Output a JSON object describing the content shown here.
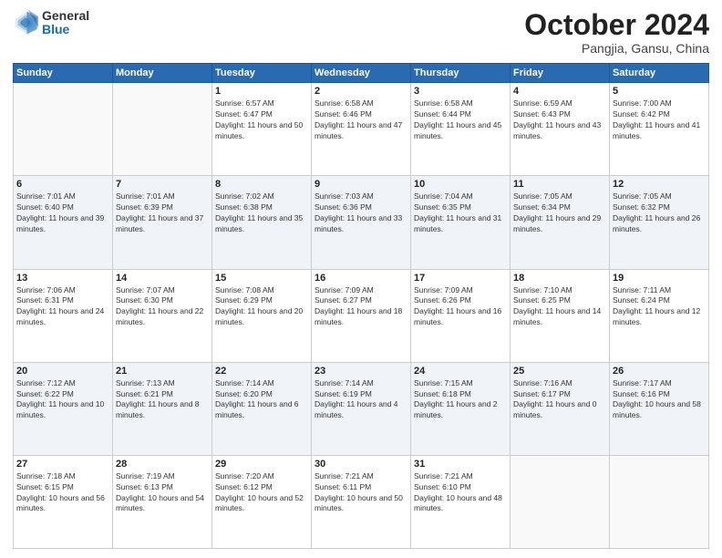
{
  "header": {
    "logo": {
      "general": "General",
      "blue": "Blue"
    },
    "title": "October 2024",
    "subtitle": "Pangjia, Gansu, China"
  },
  "days_of_week": [
    "Sunday",
    "Monday",
    "Tuesday",
    "Wednesday",
    "Thursday",
    "Friday",
    "Saturday"
  ],
  "weeks": [
    [
      {
        "day": null,
        "info": null
      },
      {
        "day": null,
        "info": null
      },
      {
        "day": "1",
        "info": "Sunrise: 6:57 AM\nSunset: 6:47 PM\nDaylight: 11 hours and 50 minutes."
      },
      {
        "day": "2",
        "info": "Sunrise: 6:58 AM\nSunset: 6:46 PM\nDaylight: 11 hours and 47 minutes."
      },
      {
        "day": "3",
        "info": "Sunrise: 6:58 AM\nSunset: 6:44 PM\nDaylight: 11 hours and 45 minutes."
      },
      {
        "day": "4",
        "info": "Sunrise: 6:59 AM\nSunset: 6:43 PM\nDaylight: 11 hours and 43 minutes."
      },
      {
        "day": "5",
        "info": "Sunrise: 7:00 AM\nSunset: 6:42 PM\nDaylight: 11 hours and 41 minutes."
      }
    ],
    [
      {
        "day": "6",
        "info": "Sunrise: 7:01 AM\nSunset: 6:40 PM\nDaylight: 11 hours and 39 minutes."
      },
      {
        "day": "7",
        "info": "Sunrise: 7:01 AM\nSunset: 6:39 PM\nDaylight: 11 hours and 37 minutes."
      },
      {
        "day": "8",
        "info": "Sunrise: 7:02 AM\nSunset: 6:38 PM\nDaylight: 11 hours and 35 minutes."
      },
      {
        "day": "9",
        "info": "Sunrise: 7:03 AM\nSunset: 6:36 PM\nDaylight: 11 hours and 33 minutes."
      },
      {
        "day": "10",
        "info": "Sunrise: 7:04 AM\nSunset: 6:35 PM\nDaylight: 11 hours and 31 minutes."
      },
      {
        "day": "11",
        "info": "Sunrise: 7:05 AM\nSunset: 6:34 PM\nDaylight: 11 hours and 29 minutes."
      },
      {
        "day": "12",
        "info": "Sunrise: 7:05 AM\nSunset: 6:32 PM\nDaylight: 11 hours and 26 minutes."
      }
    ],
    [
      {
        "day": "13",
        "info": "Sunrise: 7:06 AM\nSunset: 6:31 PM\nDaylight: 11 hours and 24 minutes."
      },
      {
        "day": "14",
        "info": "Sunrise: 7:07 AM\nSunset: 6:30 PM\nDaylight: 11 hours and 22 minutes."
      },
      {
        "day": "15",
        "info": "Sunrise: 7:08 AM\nSunset: 6:29 PM\nDaylight: 11 hours and 20 minutes."
      },
      {
        "day": "16",
        "info": "Sunrise: 7:09 AM\nSunset: 6:27 PM\nDaylight: 11 hours and 18 minutes."
      },
      {
        "day": "17",
        "info": "Sunrise: 7:09 AM\nSunset: 6:26 PM\nDaylight: 11 hours and 16 minutes."
      },
      {
        "day": "18",
        "info": "Sunrise: 7:10 AM\nSunset: 6:25 PM\nDaylight: 11 hours and 14 minutes."
      },
      {
        "day": "19",
        "info": "Sunrise: 7:11 AM\nSunset: 6:24 PM\nDaylight: 11 hours and 12 minutes."
      }
    ],
    [
      {
        "day": "20",
        "info": "Sunrise: 7:12 AM\nSunset: 6:22 PM\nDaylight: 11 hours and 10 minutes."
      },
      {
        "day": "21",
        "info": "Sunrise: 7:13 AM\nSunset: 6:21 PM\nDaylight: 11 hours and 8 minutes."
      },
      {
        "day": "22",
        "info": "Sunrise: 7:14 AM\nSunset: 6:20 PM\nDaylight: 11 hours and 6 minutes."
      },
      {
        "day": "23",
        "info": "Sunrise: 7:14 AM\nSunset: 6:19 PM\nDaylight: 11 hours and 4 minutes."
      },
      {
        "day": "24",
        "info": "Sunrise: 7:15 AM\nSunset: 6:18 PM\nDaylight: 11 hours and 2 minutes."
      },
      {
        "day": "25",
        "info": "Sunrise: 7:16 AM\nSunset: 6:17 PM\nDaylight: 11 hours and 0 minutes."
      },
      {
        "day": "26",
        "info": "Sunrise: 7:17 AM\nSunset: 6:16 PM\nDaylight: 10 hours and 58 minutes."
      }
    ],
    [
      {
        "day": "27",
        "info": "Sunrise: 7:18 AM\nSunset: 6:15 PM\nDaylight: 10 hours and 56 minutes."
      },
      {
        "day": "28",
        "info": "Sunrise: 7:19 AM\nSunset: 6:13 PM\nDaylight: 10 hours and 54 minutes."
      },
      {
        "day": "29",
        "info": "Sunrise: 7:20 AM\nSunset: 6:12 PM\nDaylight: 10 hours and 52 minutes."
      },
      {
        "day": "30",
        "info": "Sunrise: 7:21 AM\nSunset: 6:11 PM\nDaylight: 10 hours and 50 minutes."
      },
      {
        "day": "31",
        "info": "Sunrise: 7:21 AM\nSunset: 6:10 PM\nDaylight: 10 hours and 48 minutes."
      },
      {
        "day": null,
        "info": null
      },
      {
        "day": null,
        "info": null
      }
    ]
  ]
}
